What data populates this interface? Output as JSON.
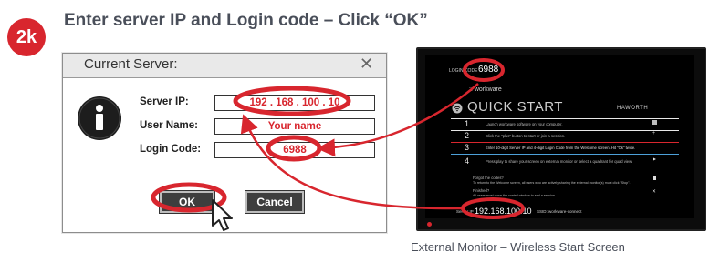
{
  "step": {
    "badge": "2k",
    "title": "Enter server IP and Login code – Click “OK”"
  },
  "dialog": {
    "title": "Current Server:",
    "close_glyph": "✕",
    "info_icon_glyph": "i",
    "fields": [
      {
        "label": "Server IP:",
        "value": "192 . 168 . 100 . 10"
      },
      {
        "label": "User Name:",
        "value": "Your name"
      },
      {
        "label": "Login Code:",
        "value": "6988"
      }
    ],
    "ok_label": "OK",
    "cancel_label": "Cancel"
  },
  "monitor": {
    "login_code_label": "LOGIN CODE",
    "login_code": "6988",
    "brand": ":: workware",
    "heading": "QUICK START",
    "haworth": "HAWORTH",
    "steps": [
      {
        "num": "1",
        "text": "Launch workware software on your computer."
      },
      {
        "num": "2",
        "text": "Click the \"plus\" button to start or join a session."
      },
      {
        "num": "3",
        "text": "Enter 10-digit Server IP and 4-digit Login Code from the Welcome screen. Hit \"Ok\" twice."
      },
      {
        "num": "4",
        "text": "Press play to share your screen on external monitor or select a quadrant for quad view."
      }
    ],
    "forgot_title": "Forgot the codes?",
    "forgot_text": "To return to the Welcome screen, all users who are actively sharing the external monitor(s) must click \"Stop\".",
    "finished_title": "Finished?",
    "finished_text": "All users must close the control window to end a session.",
    "server_label": "Server IP",
    "server_ip": "192.168.100.10",
    "ssid": "SSID: workware-connect"
  },
  "caption": "External Monitor – Wireless Start Screen",
  "colors": {
    "accent_red": "#d8262e",
    "dialog_bg": "#ffffff",
    "monitor_bg": "#000000",
    "sep_white": "#e8e8e8",
    "sep_red": "#d8262e",
    "sep_blue": "#4da0d8"
  },
  "icons": [
    "info-icon",
    "close-icon",
    "cursor-icon",
    "wifi-icon",
    "laptop-icon",
    "plus-icon",
    "play-icon",
    "stop-icon",
    "x-icon"
  ]
}
